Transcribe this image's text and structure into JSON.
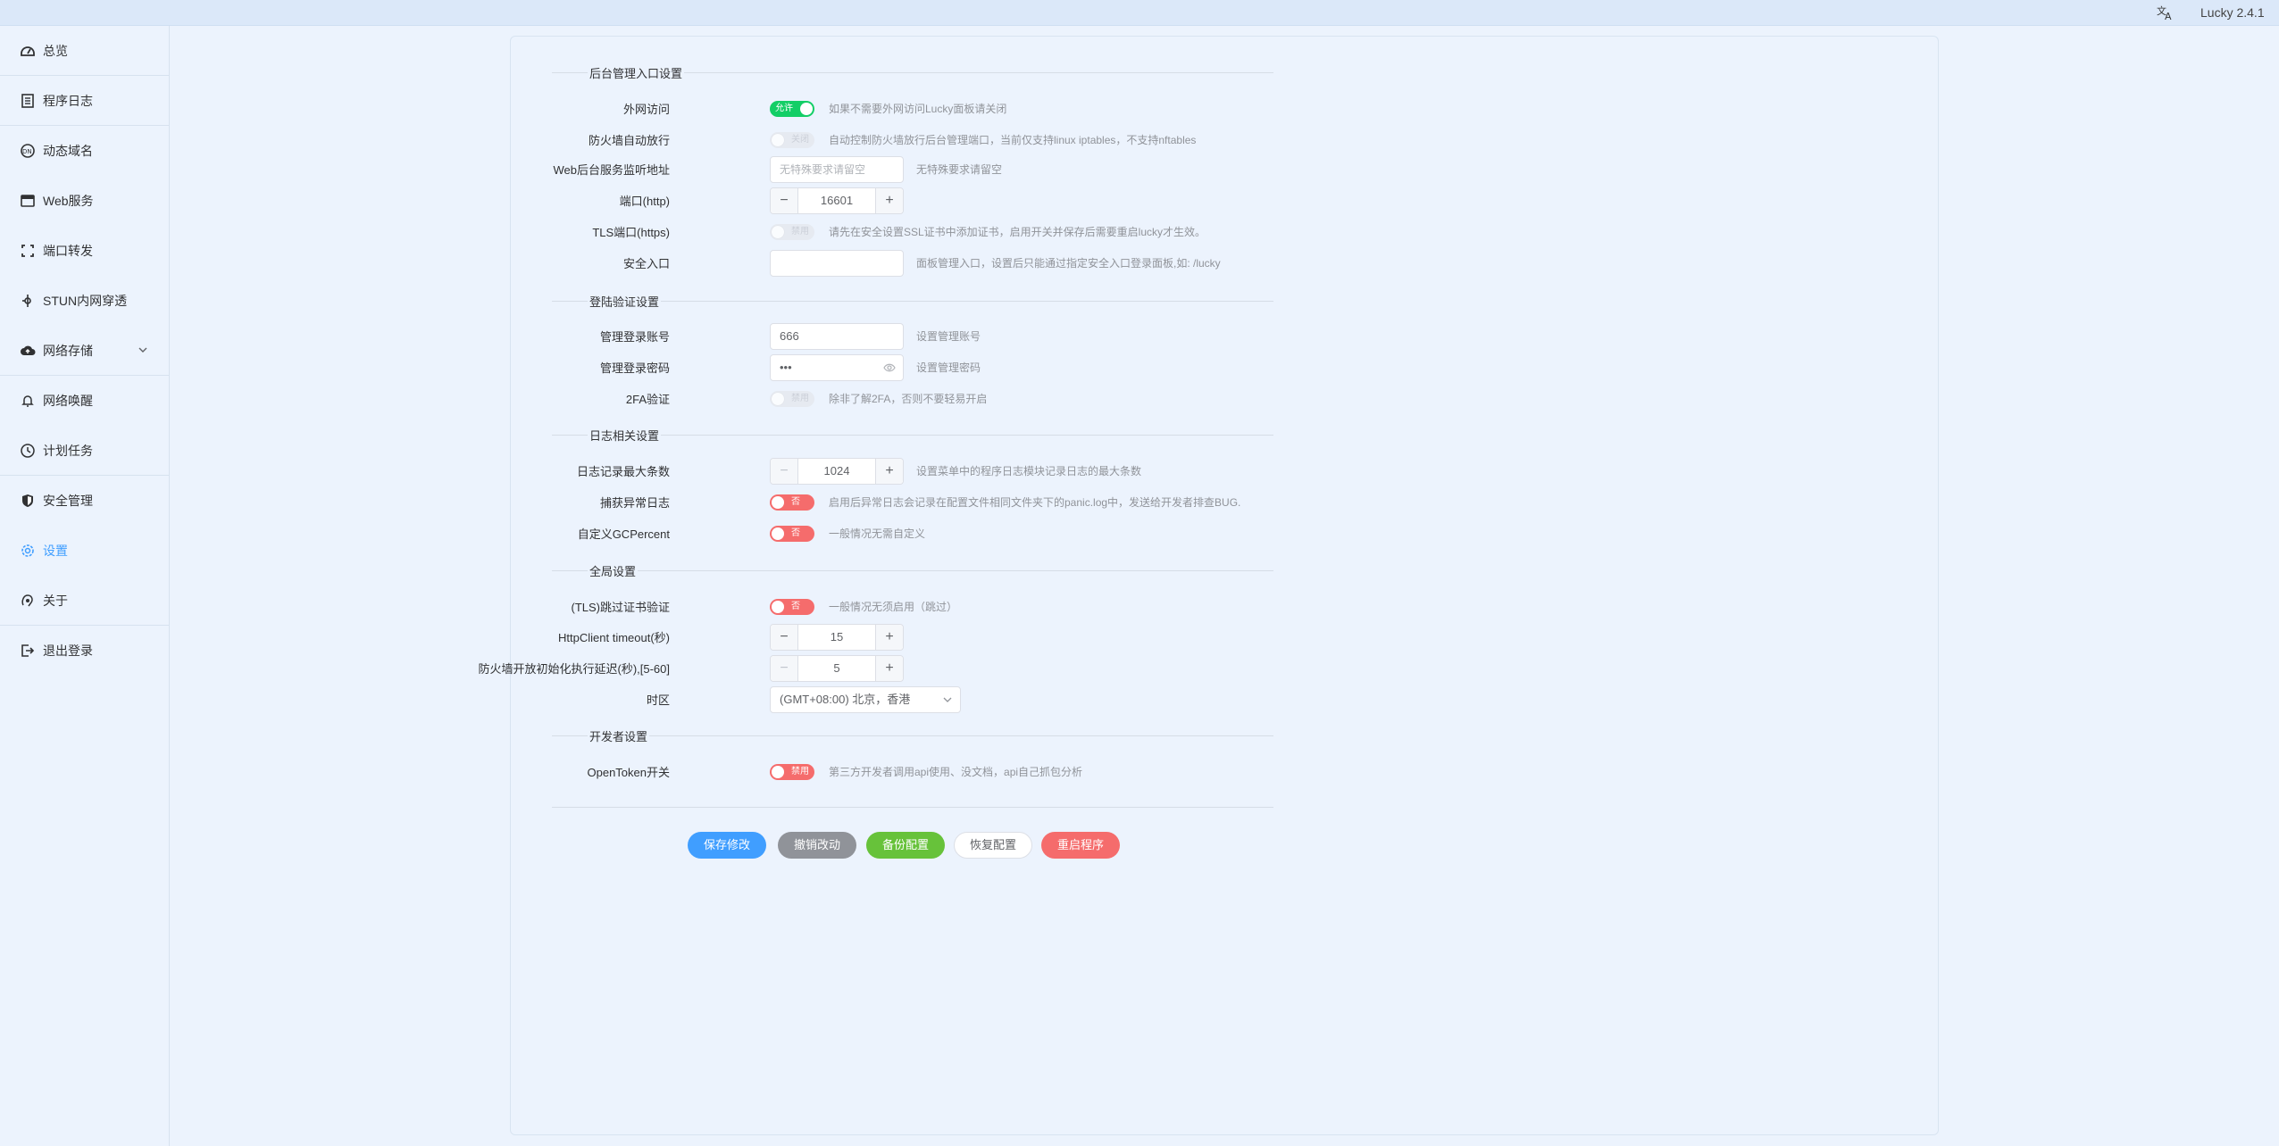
{
  "app": {
    "version": "Lucky 2.4.1",
    "lang_icon": "translate-icon"
  },
  "sidebar": {
    "items": [
      {
        "label": "总览",
        "icon": "dashboard-icon"
      },
      {
        "label": "程序日志",
        "icon": "log-icon"
      },
      {
        "label": "动态域名",
        "icon": "ddns-icon"
      },
      {
        "label": "Web服务",
        "icon": "web-icon"
      },
      {
        "label": "端口转发",
        "icon": "port-forward-icon"
      },
      {
        "label": "STUN内网穿透",
        "icon": "stun-icon"
      },
      {
        "label": "网络存储",
        "icon": "cloud-icon"
      },
      {
        "label": "网络唤醒",
        "icon": "bell-icon"
      },
      {
        "label": "计划任务",
        "icon": "clock-icon"
      },
      {
        "label": "安全管理",
        "icon": "shield-icon"
      },
      {
        "label": "设置",
        "icon": "gear-icon"
      },
      {
        "label": "关于",
        "icon": "about-icon"
      },
      {
        "label": "退出登录",
        "icon": "logout-icon"
      }
    ]
  },
  "sections": {
    "admin": "后台管理入口设置",
    "auth": "登陆验证设置",
    "log": "日志相关设置",
    "global": "全局设置",
    "dev": "开发者设置"
  },
  "fields": {
    "wan_access": {
      "label": "外网访问",
      "switch": "允许",
      "tip": "如果不需要外网访问Lucky面板请关闭"
    },
    "firewall_auto": {
      "label": "防火墙自动放行",
      "switch": "关闭",
      "tip": "自动控制防火墙放行后台管理端口，当前仅支持linux iptables，不支持nftables"
    },
    "web_listen": {
      "label": "Web后台服务监听地址",
      "placeholder": "无特殊要求请留空",
      "tip": "无特殊要求请留空"
    },
    "http_port": {
      "label": "端口(http)",
      "value": "16601"
    },
    "tls_port": {
      "label": "TLS端口(https)",
      "switch": "禁用",
      "tip": "请先在安全设置SSL证书中添加证书，启用开关并保存后需要重启lucky才生效。"
    },
    "safe_entry": {
      "label": "安全入口",
      "value": "",
      "tip": "面板管理入口，设置后只能通过指定安全入口登录面板,如: /lucky"
    },
    "admin_user": {
      "label": "管理登录账号",
      "value": "666",
      "tip": "设置管理账号"
    },
    "admin_pass": {
      "label": "管理登录密码",
      "value": "•••",
      "tip": "设置管理密码"
    },
    "twofa": {
      "label": "2FA验证",
      "switch": "禁用",
      "tip": "除非了解2FA，否则不要轻易开启"
    },
    "log_max": {
      "label": "日志记录最大条数",
      "value": "1024",
      "tip": "设置菜单中的程序日志模块记录日志的最大条数"
    },
    "panic_log": {
      "label": "捕获异常日志",
      "switch": "否",
      "tip": "启用后异常日志会记录在配置文件相同文件夹下的panic.log中，发送给开发者排查BUG."
    },
    "gc_percent": {
      "label": "自定义GCPercent",
      "switch": "否",
      "tip": "一般情况无需自定义"
    },
    "tls_skip": {
      "label": "(TLS)跳过证书验证",
      "switch": "否",
      "tip": "一般情况无须启用（跳过）"
    },
    "http_timeout": {
      "label": "HttpClient timeout(秒)",
      "value": "15"
    },
    "fw_delay": {
      "label": "防火墙开放初始化执行延迟(秒),[5-60]",
      "value": "5"
    },
    "timezone": {
      "label": "时区",
      "value": "(GMT+08:00) 北京，香港"
    },
    "open_token": {
      "label": "OpenToken开关",
      "switch": "禁用",
      "tip": "第三方开发者调用api使用、没文档，api自己抓包分析"
    }
  },
  "buttons": {
    "save": "保存修改",
    "undo": "撤销改动",
    "backup": "备份配置",
    "restore": "恢复配置",
    "restart": "重启程序"
  },
  "colors": {
    "accent": "#409eff",
    "switch_on": "#13ce66",
    "switch_red": "#f56c6c",
    "bg": "#ecf3fd"
  }
}
